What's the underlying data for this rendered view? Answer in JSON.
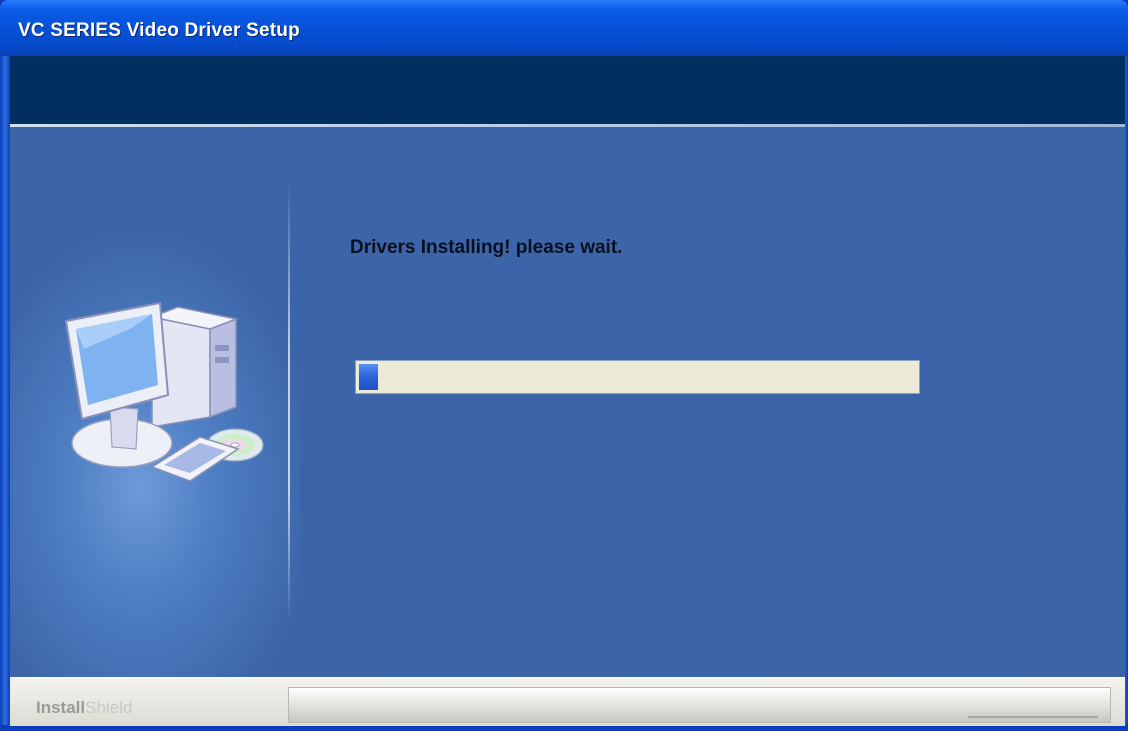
{
  "window": {
    "title": "VC SERIES Video Driver Setup"
  },
  "main": {
    "status_text": "Drivers Installing! please wait.",
    "progress_fraction": 0.035
  },
  "footer": {
    "brand_part1": "Install",
    "brand_part2": "Shield"
  },
  "icons": {
    "setup_art": "computer-with-cd-icon"
  },
  "colors": {
    "titlebar": "#0752d8",
    "header_band": "#013060",
    "content_bg": "#3c64a8",
    "progress_fill": "#2a62d8",
    "progress_track": "#ece9d8"
  }
}
